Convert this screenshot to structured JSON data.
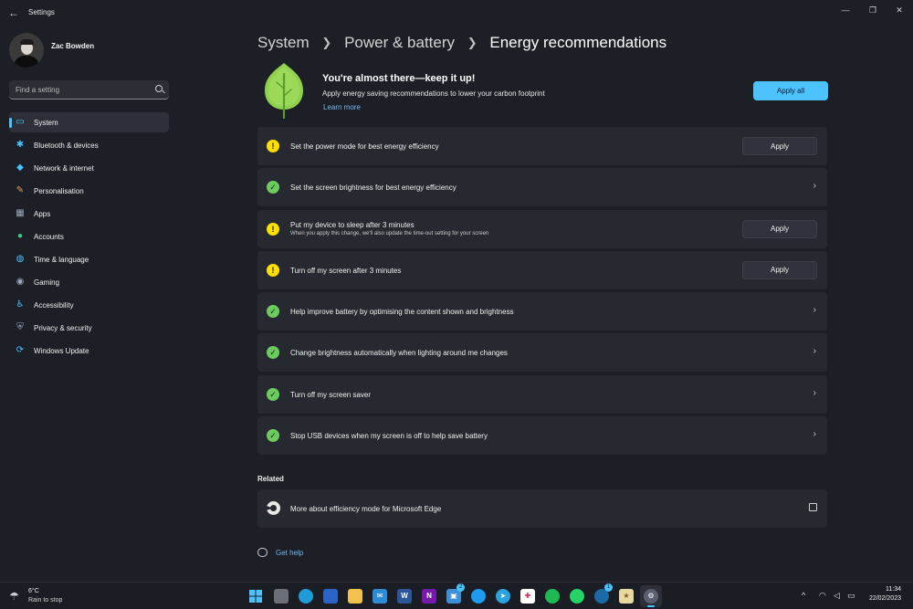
{
  "window": {
    "title": "Settings",
    "back_icon": "arrow-left-icon",
    "controls": [
      "minimize-icon",
      "restore-icon",
      "close-icon"
    ]
  },
  "profile": {
    "name": "Zac Bowden"
  },
  "search": {
    "placeholder": "Find a setting"
  },
  "sidebar": {
    "items": [
      {
        "label": "System",
        "icon": "monitor-icon",
        "color": "#4cc2ff",
        "active": true
      },
      {
        "label": "Bluetooth & devices",
        "icon": "bluetooth-icon",
        "color": "#4cc2ff"
      },
      {
        "label": "Network & internet",
        "icon": "wifi-icon",
        "color": "#4cc2ff"
      },
      {
        "label": "Personalisation",
        "icon": "brush-icon",
        "color": "#e6a15c"
      },
      {
        "label": "Apps",
        "icon": "apps-icon",
        "color": "#9fa8c0"
      },
      {
        "label": "Accounts",
        "icon": "person-icon",
        "color": "#3ecf8e"
      },
      {
        "label": "Time & language",
        "icon": "globe-icon",
        "color": "#4cc2ff"
      },
      {
        "label": "Gaming",
        "icon": "gamepad-icon",
        "color": "#9fa8c0"
      },
      {
        "label": "Accessibility",
        "icon": "accessibility-icon",
        "color": "#4cc2ff"
      },
      {
        "label": "Privacy & security",
        "icon": "shield-icon",
        "color": "#9fa8c0"
      },
      {
        "label": "Windows Update",
        "icon": "refresh-icon",
        "color": "#4cc2ff"
      }
    ]
  },
  "breadcrumb": {
    "first": "System",
    "second": "Power & battery",
    "current": "Energy recommendations"
  },
  "header": {
    "title": "You're almost there—keep it up!",
    "subtitle": "Apply energy saving recommendations to lower your carbon footprint",
    "link": "Learn more",
    "apply_all": "Apply all",
    "leaf_color": "#8fd14f"
  },
  "recommendations": [
    {
      "title": "Set the power mode for best energy efficiency",
      "status": "warning",
      "action": "Apply"
    },
    {
      "title": "Set the screen brightness for best energy efficiency",
      "status": "done",
      "action": "chevron"
    },
    {
      "title": "Put my device to sleep after 3 minutes",
      "description": "When you apply this change, we'll also update the time-out setting for your screen",
      "status": "warning",
      "action": "Apply"
    },
    {
      "title": "Turn off my screen after 3 minutes",
      "status": "warning",
      "action": "Apply"
    },
    {
      "title": "Help improve battery by optimising the content shown and brightness",
      "status": "done",
      "action": "chevron"
    },
    {
      "title": "Change brightness automatically when lighting around me changes",
      "status": "done",
      "action": "chevron"
    },
    {
      "title": "Turn off my screen saver",
      "status": "done",
      "action": "chevron"
    },
    {
      "title": "Stop USB devices when my screen is off to help save battery",
      "status": "done",
      "action": "chevron"
    }
  ],
  "related": {
    "heading": "Related",
    "item": "More about efficiency mode for Microsoft Edge"
  },
  "help": {
    "label": "Get help"
  },
  "taskbar": {
    "weather": {
      "temp": "6°C",
      "condition": "Rain to stop"
    },
    "clock": {
      "time": "11:34",
      "date": "22/02/2023"
    }
  }
}
